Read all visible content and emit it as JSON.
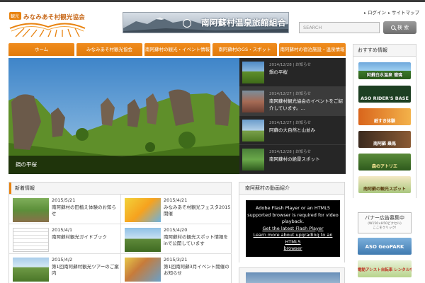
{
  "site": {
    "logo_text": "みなみあそ村観光協会",
    "banner_text": "南阿蘇村温泉旅館組合"
  },
  "util": {
    "link1": "ログイン",
    "link2": "サイトマップ"
  },
  "search": {
    "placeholder": "SEARCH",
    "button_label": "検 索"
  },
  "nav": {
    "items": [
      {
        "label": "ホーム"
      },
      {
        "label": "みなみあそ村観光協会"
      },
      {
        "label": "南阿蘇村の観光・イベント情報"
      },
      {
        "label": "南阿蘇村のGS・スポット"
      },
      {
        "label": "南阿蘇村の宿泊施設・温泉情報"
      }
    ]
  },
  "slider": {
    "caption": "鍋の平桜",
    "thumbs": [
      {
        "meta": "2014/12/28 | お知らせ",
        "title": "鍋の平桜"
      },
      {
        "meta": "2014/12/27 | お知らせ",
        "title": "南阿蘇村観光協会のイベントをご紹介しています。..."
      },
      {
        "meta": "2014/12/27 | お知らせ",
        "title": "阿蘇の大自然と山並み"
      },
      {
        "meta": "2014/12/28 | お知らせ",
        "title": "南阿蘇村の絶景スポット"
      }
    ]
  },
  "sidebar": {
    "title": "おすすめ情報",
    "banners": [
      {
        "label": "阿蘇白水温泉 瑠璃"
      },
      {
        "label": "ASO RIDER'S BASE"
      },
      {
        "label": "紙すき体験"
      },
      {
        "label": "南阿蘇 乗馬"
      },
      {
        "label": "森のアトリエ"
      },
      {
        "label": "南阿蘇の観光スポット"
      }
    ],
    "ad": {
      "line1": "バナー広告募集中",
      "line2": "(W150×H50ピクセル)",
      "line3": "ここをクリック!"
    },
    "geopark_label": "ASO GeoPARK",
    "ebike_label": "電動アシスト自転車 レンタル中!"
  },
  "news": {
    "heading": "新着情報",
    "items": [
      {
        "date": "2015/5/21",
        "title": "南阿蘇村の田植え体験のお知らせ"
      },
      {
        "date": "2015/4/21",
        "title": "みなみあそ村観光フェスタ2015開催"
      },
      {
        "date": "2015/4/1",
        "title": "南阿蘇村観光ガイドブック"
      },
      {
        "date": "2015/4/20",
        "title": "南阿蘇村の観光スポット情報をinで公開しています"
      },
      {
        "date": "2015/4/2",
        "title": "第1回南阿蘇村観光ツアーのご案内"
      },
      {
        "date": "2015/3/21",
        "title": "第1回南阿蘇3月イベント開催のお知らせ"
      }
    ]
  },
  "movie": {
    "heading": "南阿蘇村の動画紹介",
    "flash_line1": "Adobe Flash Player or an HTML5",
    "flash_line2": "supported browser is required for video",
    "flash_line3": "playback.",
    "flash_link1": "Get the latest Flash Player",
    "flash_link2": "Learn more about upgrading to an HTML5",
    "flash_link3": "browser"
  }
}
